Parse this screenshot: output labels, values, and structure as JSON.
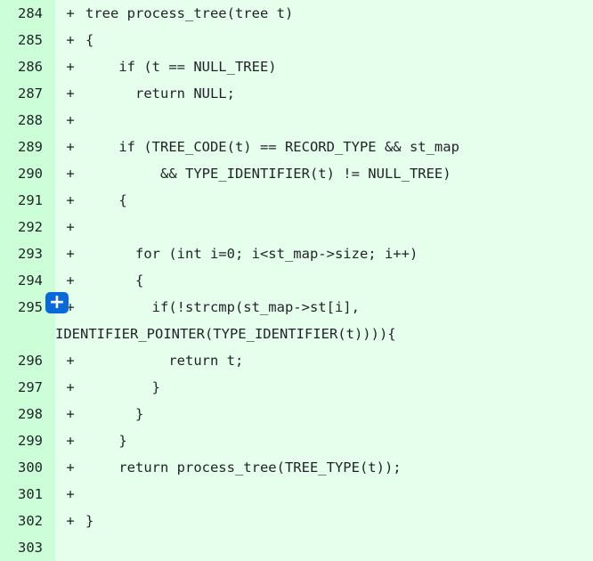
{
  "add_comment_symbol": "+",
  "lines": [
    {
      "num": "284",
      "marker": "+",
      "code": "tree process_tree(tree t)"
    },
    {
      "num": "285",
      "marker": "+",
      "code": "{"
    },
    {
      "num": "286",
      "marker": "+",
      "code": "    if (t == NULL_TREE)"
    },
    {
      "num": "287",
      "marker": "+",
      "code": "      return NULL;"
    },
    {
      "num": "288",
      "marker": "+",
      "code": ""
    },
    {
      "num": "289",
      "marker": "+",
      "code": "    if (TREE_CODE(t) == RECORD_TYPE && st_map"
    },
    {
      "num": "290",
      "marker": "+",
      "code": "         && TYPE_IDENTIFIER(t) != NULL_TREE)"
    },
    {
      "num": "291",
      "marker": "+",
      "code": "    {"
    },
    {
      "num": "292",
      "marker": "+",
      "code": ""
    },
    {
      "num": "293",
      "marker": "+",
      "code": "      for (int i=0; i<st_map->size; i++)"
    },
    {
      "num": "294",
      "marker": "+",
      "code": "      {"
    },
    {
      "num": "295",
      "marker": "+",
      "code": "        if(!strcmp(st_map->st[i],",
      "wrap": "IDENTIFIER_POINTER(TYPE_IDENTIFIER(t)))){"
    },
    {
      "num": "296",
      "marker": "+",
      "code": "          return t;"
    },
    {
      "num": "297",
      "marker": "+",
      "code": "        }"
    },
    {
      "num": "298",
      "marker": "+",
      "code": "      }"
    },
    {
      "num": "299",
      "marker": "+",
      "code": "    }"
    },
    {
      "num": "300",
      "marker": "+",
      "code": "    return process_tree(TREE_TYPE(t));"
    },
    {
      "num": "301",
      "marker": "+",
      "code": ""
    },
    {
      "num": "302",
      "marker": "+",
      "code": "}"
    },
    {
      "num": "303",
      "marker": "",
      "code": ""
    }
  ]
}
